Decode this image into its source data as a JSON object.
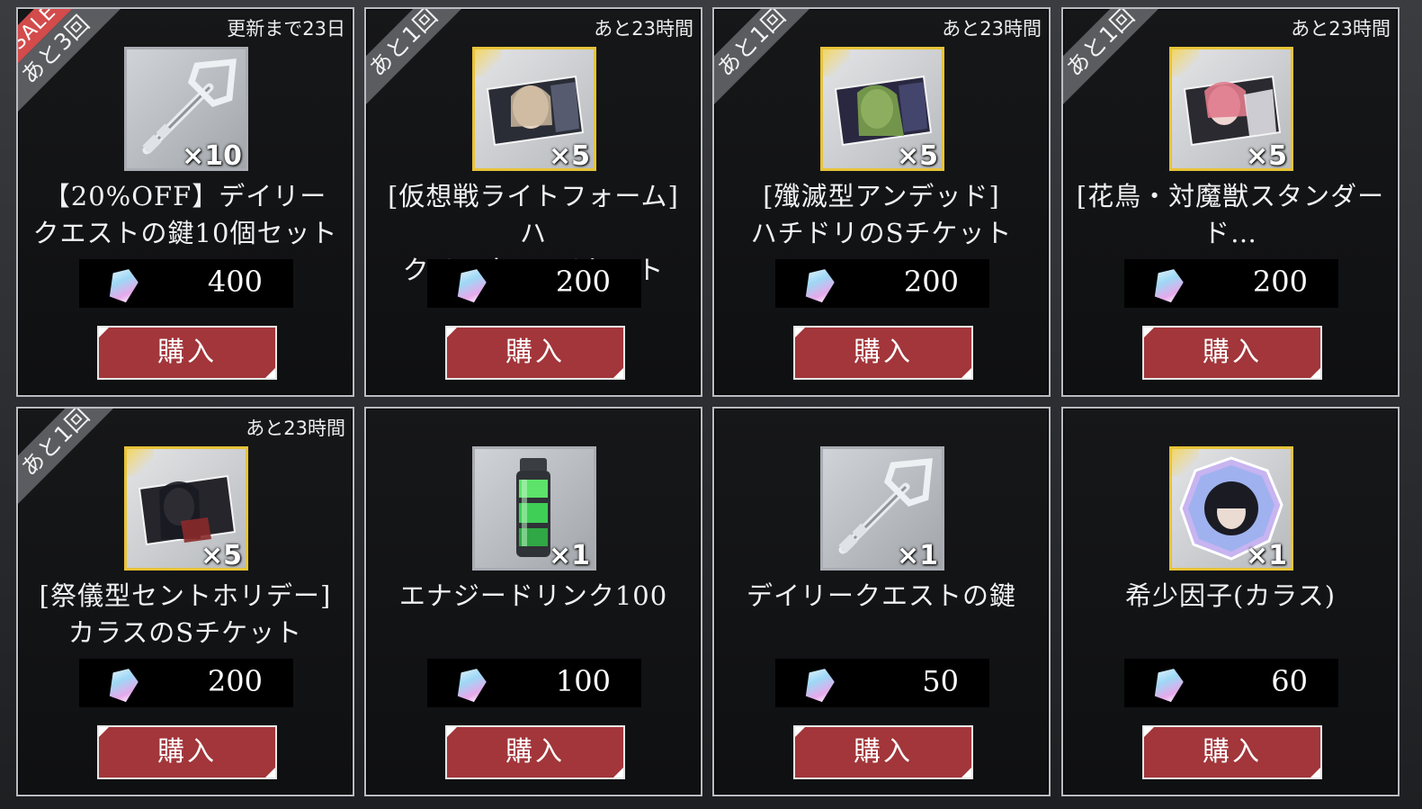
{
  "ui": {
    "buy_label": "購入"
  },
  "items": [
    {
      "badge_sale": "SALE",
      "badge": "あと3回",
      "timer": "更新まで23日",
      "icon": "key-icon",
      "qty": "×10",
      "name": "【20%OFF】デイリー\nクエストの鍵10個セット",
      "price": "400"
    },
    {
      "badge": "あと1回",
      "timer": "あと23時間",
      "icon": "s-ticket-icon",
      "qty": "×5",
      "name": "[仮想戦ライトフォーム]ハ\nクチョウのSチケット",
      "price": "200"
    },
    {
      "badge": "あと1回",
      "timer": "あと23時間",
      "icon": "s-ticket-icon",
      "qty": "×5",
      "name": "[殲滅型アンデッド]\nハチドリのSチケット",
      "price": "200"
    },
    {
      "badge": "あと1回",
      "timer": "あと23時間",
      "icon": "s-ticket-icon",
      "qty": "×5",
      "name": "[花鳥・対魔獣スタンダー\nド…",
      "price": "200"
    },
    {
      "badge": "あと1回",
      "timer": "あと23時間",
      "icon": "s-ticket-icon",
      "qty": "×5",
      "name": "[祭儀型セントホリデー]\nカラスのSチケット",
      "price": "200"
    },
    {
      "icon": "energy-drink-icon",
      "qty": "×1",
      "name": "エナジードリンク100",
      "price": "100"
    },
    {
      "icon": "key-icon",
      "qty": "×1",
      "name": "デイリークエストの鍵",
      "price": "50"
    },
    {
      "icon": "rare-factor-icon",
      "qty": "×1",
      "name": "希少因子(カラス)",
      "price": "60"
    }
  ],
  "colors": {
    "buy_button": "#a2363a",
    "sale_ribbon": "#d34b4b",
    "gold_frame": "#e7c338",
    "silver_frame": "#a9adb3"
  }
}
